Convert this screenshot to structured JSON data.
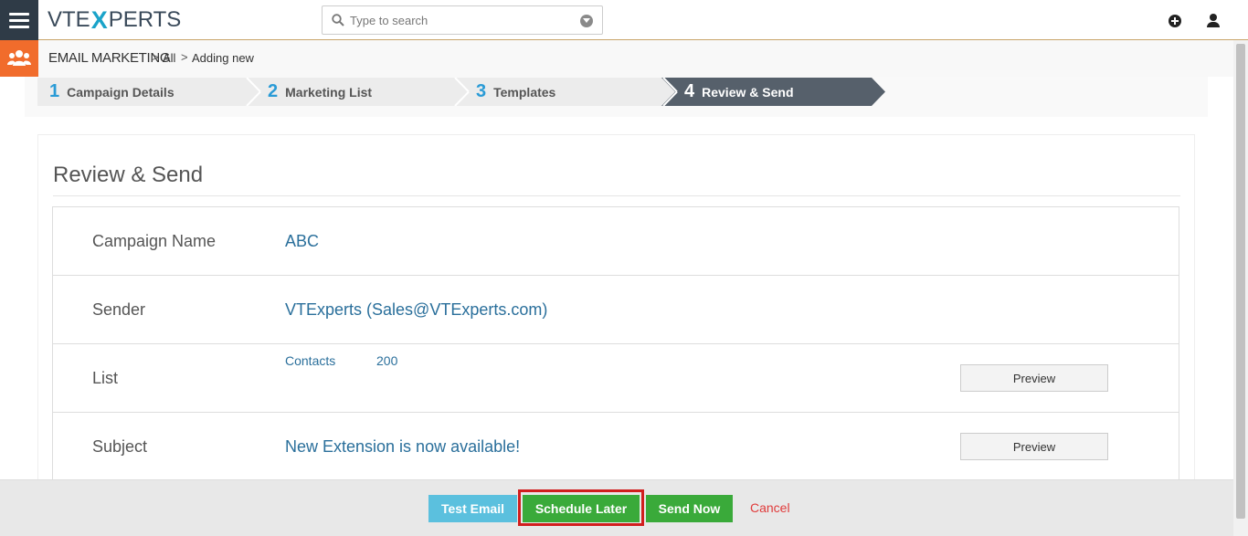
{
  "app": {
    "logo_prefix": "VTE",
    "logo_x": "X",
    "logo_suffix": "PERTS"
  },
  "search": {
    "placeholder": "Type to search"
  },
  "breadcrumb": {
    "module": "EMAIL MARKETING",
    "separator": ">",
    "all": "All",
    "current": "Adding new"
  },
  "steps": [
    {
      "num": "1",
      "label": "Campaign Details"
    },
    {
      "num": "2",
      "label": "Marketing List"
    },
    {
      "num": "3",
      "label": "Templates"
    },
    {
      "num": "4",
      "label": "Review & Send"
    }
  ],
  "review": {
    "title": "Review & Send",
    "rows": {
      "campaign_name": {
        "label": "Campaign Name",
        "value": "ABC"
      },
      "sender": {
        "label": "Sender",
        "value": "VTExperts (Sales@VTExperts.com)"
      },
      "list": {
        "label": "List",
        "list_name": "Contacts",
        "count": "200",
        "preview": "Preview"
      },
      "subject": {
        "label": "Subject",
        "value": "New Extension is now available!",
        "preview": "Preview"
      }
    }
  },
  "footer": {
    "test_email": "Test Email",
    "schedule_later": "Schedule Later",
    "send_now": "Send Now",
    "cancel": "Cancel"
  },
  "colors": {
    "accent_blue": "#2a9bd6",
    "active_step": "#56606b",
    "module_orange": "#f16c2c",
    "success_green": "#3aaa3a",
    "info_cyan": "#5bc0de",
    "highlight_red": "#d11e1e"
  }
}
